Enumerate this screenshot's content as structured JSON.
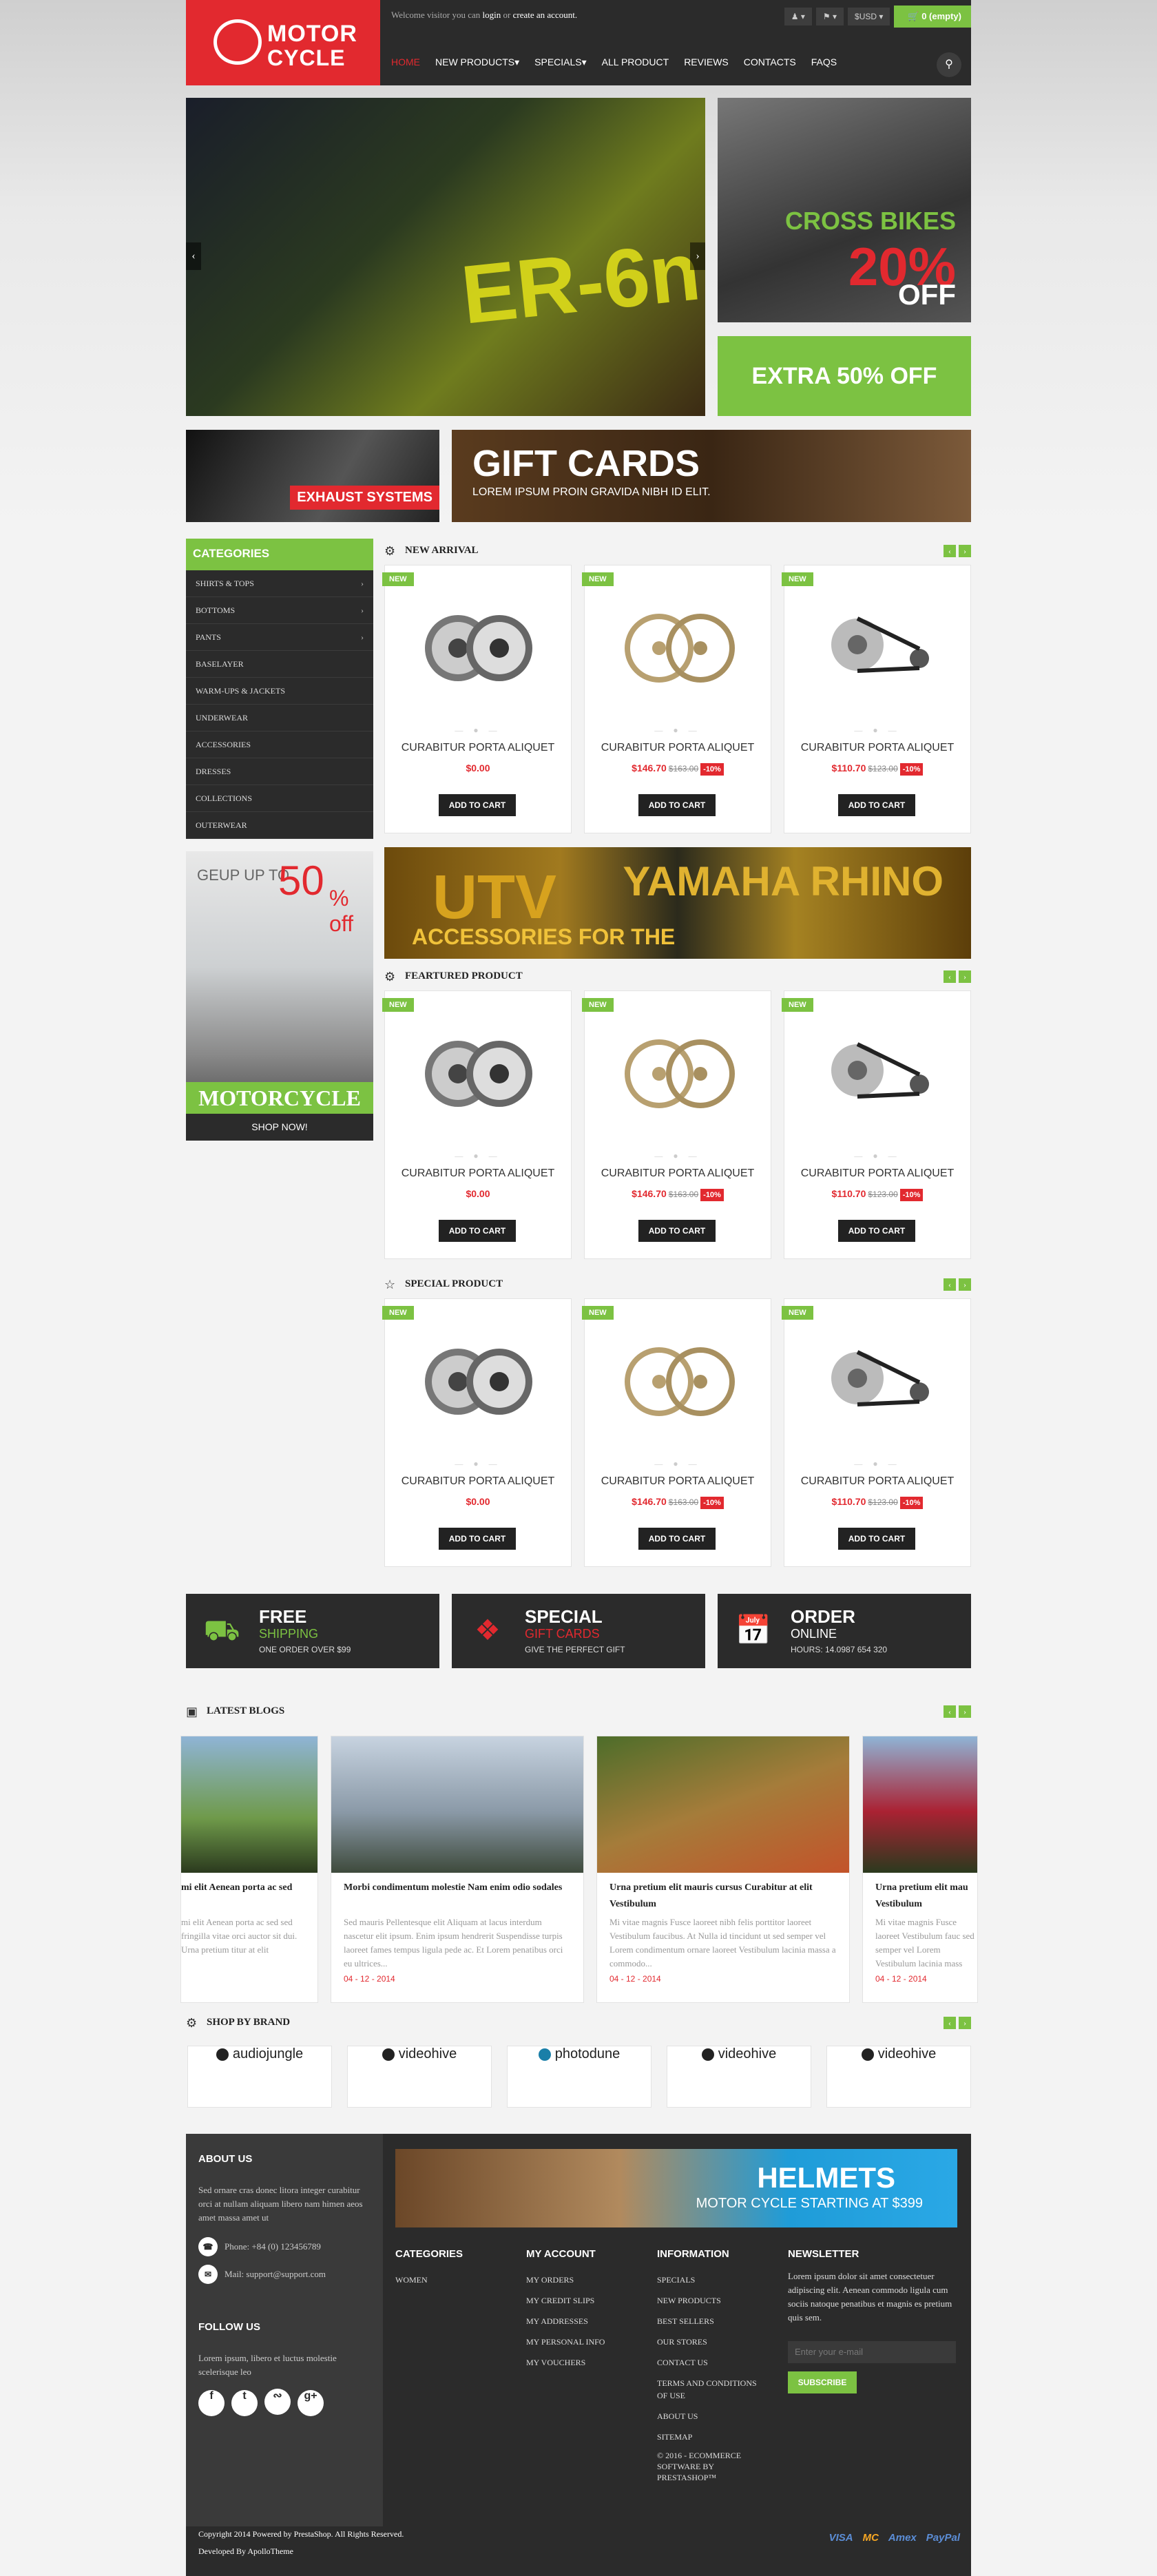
{
  "header": {
    "logo_line1": "MOTOR",
    "logo_line2": "CYCLE",
    "welcome_prefix": "Welcome visitor you can",
    "login": "login",
    "or": "or",
    "create_account": "create an account.",
    "currency": "$USD",
    "cart": "0 (empty)",
    "nav": [
      "HOME",
      "NEW PRODUCTS",
      "SPECIALS",
      "ALL PRODUCT",
      "REVIEWS",
      "CONTACTS",
      "FAQS"
    ]
  },
  "banners": {
    "main_text": "ER-6n",
    "cross_bikes": "CROSS BIKES",
    "cross_pct": "20%",
    "cross_off": "OFF",
    "extra": "EXTRA 50% OFF",
    "exhaust": "EXHAUST SYSTEMS",
    "gift_title": "GIFT CARDS",
    "gift_sub": "LOREM IPSUM PROIN GRAVIDA NIBH ID ELIT.",
    "utv1": "UTV",
    "utv2": "ACCESSORIES FOR THE",
    "utv3": "YAMAHA RHINO"
  },
  "categories": {
    "title": "CATEGORIES",
    "items": [
      "SHIRTS & TOPS",
      "BOTTOMS",
      "PANTS",
      "BASELAYER",
      "WARM-UPS & JACKETS",
      "UNDERWEAR",
      "ACCESSORIES",
      "DRESSES",
      "COLLECTIONS",
      "OUTERWEAR"
    ]
  },
  "promo": {
    "geup": "GEUP UP TO",
    "pct": "50",
    "off": "% off",
    "title": "MOTORCYCLE",
    "cta": "SHOP NOW!"
  },
  "sections": [
    {
      "title": "NEW ARRIVAL"
    },
    {
      "title": "FEARTURED PRODUCT"
    },
    {
      "title": "SPECIAL PRODUCT"
    }
  ],
  "product": {
    "badge": "NEW",
    "name": "CURABITUR PORTA ALIQUET",
    "add": "ADD TO CART",
    "p1": "$0.00",
    "p2": "$146.70",
    "p2_old": "$163.00",
    "p2_disc": "-10%",
    "p3": "$110.70",
    "p3_old": "$123.00",
    "p3_disc": "-10%"
  },
  "services": [
    {
      "t1": "FREE",
      "t2": "SHIPPING",
      "t3": "ONE ORDER OVER $99"
    },
    {
      "t1": "SPECIAL",
      "t2": "GIFT CARDS",
      "t3": "GIVE THE PERFECT GIFT"
    },
    {
      "t1": "ORDER",
      "t2": "ONLINE",
      "t3": "HOURS: 14.0987 654 320"
    }
  ],
  "blogs": {
    "title": "LATEST BLOGS",
    "items": [
      {
        "title": "mi elit Aenean porta ac sed",
        "body": "mi elit Aenean porta ac sed sed fringilla vitae orci auctor sit dui. Urna pretium titur at elit",
        "date": ""
      },
      {
        "title": "Morbi condimentum molestie Nam enim odio sodales",
        "body": "Sed mauris Pellentesque elit Aliquam at lacus interdum nascetur elit ipsum. Enim ipsum hendrerit Suspendisse turpis laoreet fames tempus ligula pede ac. Et Lorem penatibus orci eu ultrices...",
        "date": "04 - 12 - 2014"
      },
      {
        "title": "Urna pretium elit mauris cursus Curabitur at elit Vestibulum",
        "body": "Mi vitae magnis Fusce laoreet nibh felis porttitor laoreet Vestibulum faucibus. At Nulla id tincidunt ut sed semper vel Lorem condimentum ornare laoreet Vestibulum lacinia massa a commodo...",
        "date": "04 - 12 - 2014"
      },
      {
        "title": "Urna pretium elit mau Vestibulum",
        "body": "Mi vitae magnis Fusce laoreet Vestibulum fauc sed semper vel Lorem Vestibulum lacinia mass",
        "date": "04 - 12 - 2014"
      }
    ]
  },
  "brands": {
    "title": "SHOP BY BRAND",
    "items": [
      "audiojungle",
      "videohive",
      "photodune",
      "videohive",
      "videohive"
    ]
  },
  "footer": {
    "about_title": "ABOUT US",
    "about_text": "Sed ornare cras donec litora integer curabitur orci at nullam aliquam libero nam himen aeos amet massa amet ut",
    "phone": "Phone: +84 (0) 123456789",
    "mail": "Mail: support@support.com",
    "follow_title": "FOLLOW US",
    "follow_text": "Lorem ipsum, libero et luctus molestie scelerisque leo",
    "helmets_title": "HELMETS",
    "helmets_sub": "MOTOR CYCLE STARTING AT $399",
    "categories_title": "CATEGORIES",
    "categories": [
      "WOMEN"
    ],
    "account_title": "MY ACCOUNT",
    "account": [
      "MY ORDERS",
      "MY CREDIT SLIPS",
      "MY ADDRESSES",
      "MY PERSONAL INFO",
      "MY VOUCHERS"
    ],
    "info_title": "INFORMATION",
    "info": [
      "SPECIALS",
      "NEW PRODUCTS",
      "BEST SELLERS",
      "OUR STORES",
      "CONTACT US",
      "TERMS AND CONDITIONS OF USE",
      "ABOUT US",
      "SITEMAP",
      "© 2016 - ECOMMERCE SOFTWARE BY PRESTASHOP™"
    ],
    "news_title": "NEWSLETTER",
    "news_text": "Lorem ipsum dolor sit amet consectetuer adipiscing elit. Aenean commodo ligula cum sociis natoque penatibus et magnis es pretium quis sem.",
    "news_placeholder": "Enter your e-mail",
    "subscribe": "SUBSCRIBE",
    "copyright": "Copyright 2014 Powered by PrestaShop. All Rights Reserved.",
    "developed": "Developed By ApolloTheme",
    "pay": [
      "VISA",
      "MC",
      "Amex",
      "PayPal"
    ]
  },
  "colors": {
    "accent": "#7cc242",
    "brand": "#e2292f",
    "dark": "#2b2b2b"
  }
}
